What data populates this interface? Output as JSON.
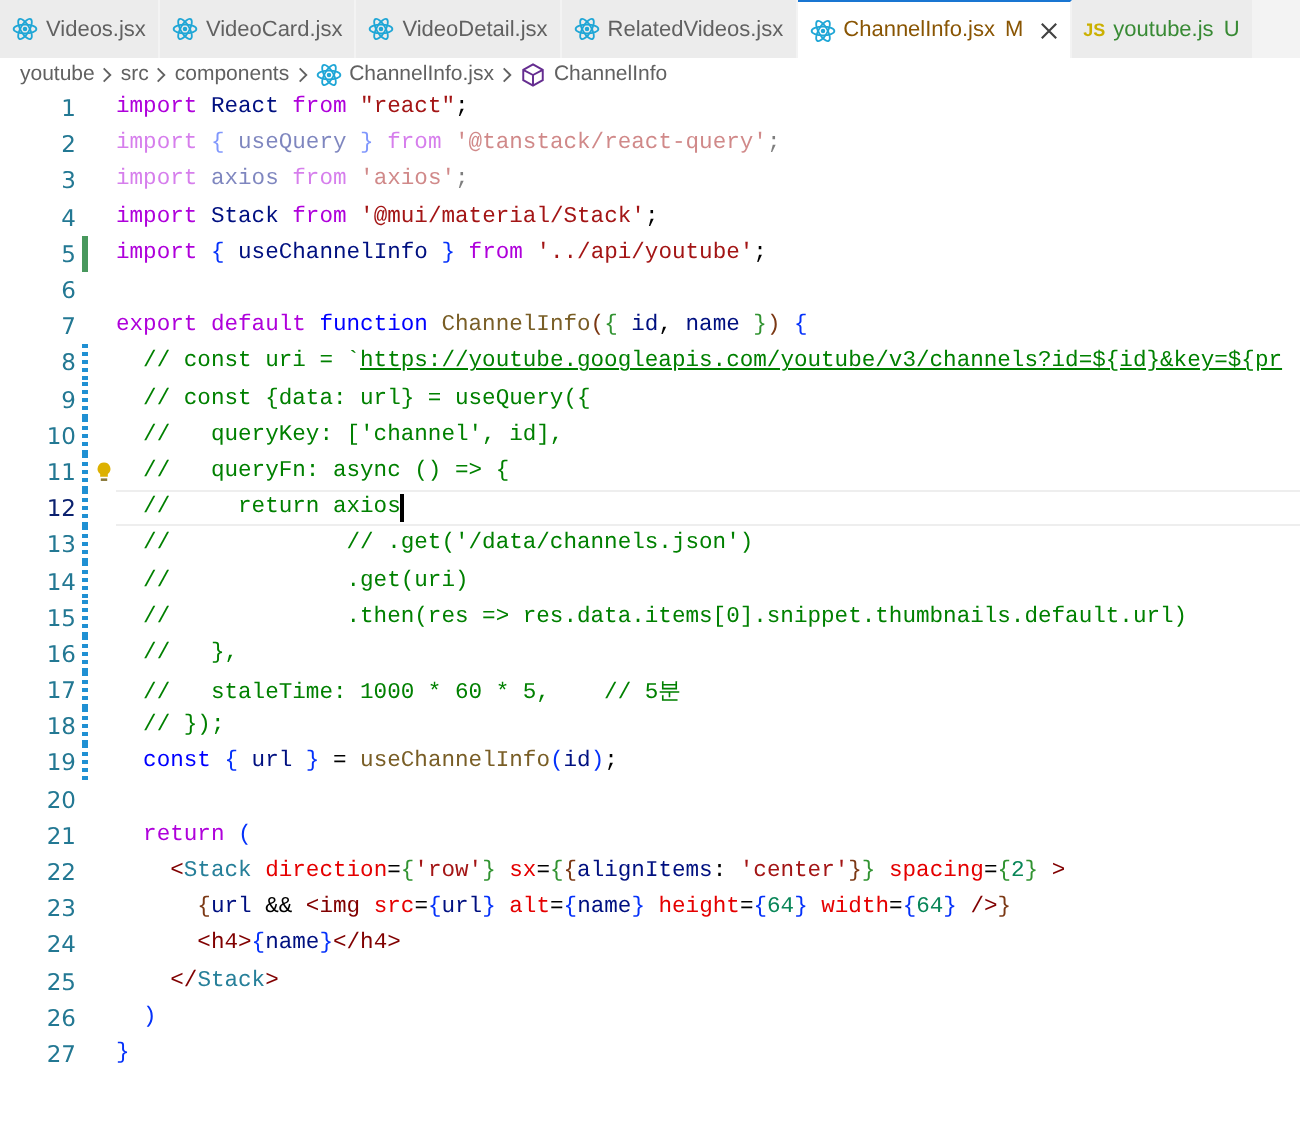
{
  "tabs": [
    {
      "label": "Videos.jsx",
      "kind": "react",
      "selected": false
    },
    {
      "label": "VideoCard.jsx",
      "kind": "react",
      "selected": false
    },
    {
      "label": "VideoDetail.jsx",
      "kind": "react",
      "selected": false
    },
    {
      "label": "RelatedVideos.jsx",
      "kind": "react",
      "selected": false
    },
    {
      "label": "ChannelInfo.jsx",
      "kind": "react",
      "selected": true,
      "status": {
        "letter": "M",
        "kind": "modified"
      }
    },
    {
      "label": "youtube.js",
      "kind": "js",
      "icon_label": "JS",
      "selected": false,
      "status": {
        "letter": "U",
        "kind": "untracked"
      }
    }
  ],
  "breadcrumb": [
    {
      "label": "youtube",
      "kind": "folder"
    },
    {
      "label": "src",
      "kind": "folder"
    },
    {
      "label": "components",
      "kind": "folder"
    },
    {
      "label": "ChannelInfo.jsx",
      "kind": "react"
    },
    {
      "label": "ChannelInfo",
      "kind": "symbol"
    }
  ],
  "lines": [
    {
      "number": "1",
      "current": false,
      "tokens": [
        {
          "t": "import",
          "kind": "kw"
        },
        {
          "t": " React",
          "kind": "var"
        },
        {
          "t": " from",
          "kind": "kw"
        },
        {
          "t": " \"react\"",
          "kind": "str"
        },
        {
          "t": ";",
          "kind": "p"
        }
      ]
    },
    {
      "number": "2",
      "current": false,
      "faded": true,
      "tokens": [
        {
          "t": "import",
          "kind": "kw"
        },
        {
          "t": " {",
          "kind": "b1"
        },
        {
          "t": " useQuery",
          "kind": "var"
        },
        {
          "t": " }",
          "kind": "b1"
        },
        {
          "t": " from",
          "kind": "kw"
        },
        {
          "t": " '@tanstack/react-query'",
          "kind": "str"
        },
        {
          "t": ";",
          "kind": "p"
        }
      ]
    },
    {
      "number": "3",
      "current": false,
      "faded": true,
      "tokens": [
        {
          "t": "import",
          "kind": "kw"
        },
        {
          "t": " axios",
          "kind": "var"
        },
        {
          "t": " from",
          "kind": "kw"
        },
        {
          "t": " 'axios'",
          "kind": "str"
        },
        {
          "t": ";",
          "kind": "p"
        }
      ]
    },
    {
      "number": "4",
      "current": false,
      "tokens": [
        {
          "t": "import",
          "kind": "kw"
        },
        {
          "t": " Stack",
          "kind": "var"
        },
        {
          "t": " from",
          "kind": "kw"
        },
        {
          "t": " '@mui/material/Stack'",
          "kind": "str"
        },
        {
          "t": ";",
          "kind": "p"
        }
      ]
    },
    {
      "number": "5",
      "kind": "added",
      "current": false,
      "tokens": [
        {
          "t": "import",
          "kind": "kw"
        },
        {
          "t": " {",
          "kind": "b1"
        },
        {
          "t": " useChannelInfo",
          "kind": "var"
        },
        {
          "t": " }",
          "kind": "b1"
        },
        {
          "t": " from",
          "kind": "kw"
        },
        {
          "t": " '../api/youtube'",
          "kind": "str"
        },
        {
          "t": ";",
          "kind": "p"
        }
      ]
    },
    {
      "number": "6",
      "current": false
    },
    {
      "number": "7",
      "current": false,
      "tokens": [
        {
          "t": "export",
          "kind": "kw"
        },
        {
          "t": " default",
          "kind": "kw"
        },
        {
          "t": " function",
          "kind": "kw2"
        },
        {
          "t": " ChannelInfo",
          "kind": "fn"
        },
        {
          "t": "(",
          "kind": "b3"
        },
        {
          "t": "{",
          "kind": "b2"
        },
        {
          "t": " id",
          "kind": "var"
        },
        {
          "t": ",",
          "kind": "p"
        },
        {
          "t": " name",
          "kind": "var"
        },
        {
          "t": " }",
          "kind": "b2"
        },
        {
          "t": ")",
          "kind": "b3"
        },
        {
          "t": " {",
          "kind": "b1"
        }
      ]
    },
    {
      "number": "8",
      "kind": "modified",
      "current": false,
      "tokens": [
        {
          "t": "  // const uri = `",
          "kind": "com"
        },
        {
          "t": "https://youtube.googleapis.com/youtube/v3/channels?id=${id}&key=${pr",
          "kind": "link"
        }
      ]
    },
    {
      "number": "9",
      "kind": "modified",
      "current": false,
      "tokens": [
        {
          "t": "  // const {data: url} = useQuery({",
          "kind": "com"
        }
      ]
    },
    {
      "number": "10",
      "kind": "modified",
      "current": false,
      "tokens": [
        {
          "t": "  //   queryKey: ['channel', id],",
          "kind": "com"
        }
      ]
    },
    {
      "number": "11",
      "kind": "modified",
      "current": false,
      "lightbulb": true,
      "tokens": [
        {
          "t": "  //   queryFn: async () => {",
          "kind": "com"
        }
      ]
    },
    {
      "number": "12",
      "kind": "modified",
      "current": true,
      "cursor": true,
      "tokens": [
        {
          "t": "  //     return axios",
          "kind": "com"
        }
      ]
    },
    {
      "number": "13",
      "kind": "modified",
      "current": false,
      "tokens": [
        {
          "t": "  //             // .get('/data/channels.json')",
          "kind": "com"
        }
      ]
    },
    {
      "number": "14",
      "kind": "modified",
      "current": false,
      "tokens": [
        {
          "t": "  //             .get(uri)",
          "kind": "com"
        }
      ]
    },
    {
      "number": "15",
      "kind": "modified",
      "current": false,
      "tokens": [
        {
          "t": "  //             .then(res => res.data.items[0].snippet.thumbnails.default.url)",
          "kind": "com"
        }
      ]
    },
    {
      "number": "16",
      "kind": "modified",
      "current": false,
      "tokens": [
        {
          "t": "  //   },",
          "kind": "com"
        }
      ]
    },
    {
      "number": "17",
      "kind": "modified",
      "current": false,
      "tokens": [
        {
          "t": "  //   staleTime: 1000 * 60 * 5,    // 5분",
          "kind": "com"
        }
      ]
    },
    {
      "number": "18",
      "kind": "modified",
      "current": false,
      "tokens": [
        {
          "t": "  // });",
          "kind": "com"
        }
      ]
    },
    {
      "number": "19",
      "kind": "modified",
      "current": false,
      "tokens": [
        {
          "t": "  const",
          "kind": "kw2"
        },
        {
          "t": " {",
          "kind": "b1"
        },
        {
          "t": " url",
          "kind": "var"
        },
        {
          "t": " }",
          "kind": "b1"
        },
        {
          "t": " =",
          "kind": "p"
        },
        {
          "t": " useChannelInfo",
          "kind": "fn"
        },
        {
          "t": "(",
          "kind": "b1"
        },
        {
          "t": "id",
          "kind": "var"
        },
        {
          "t": ")",
          "kind": "b1"
        },
        {
          "t": ";",
          "kind": "p"
        }
      ]
    },
    {
      "number": "20",
      "current": false
    },
    {
      "number": "21",
      "current": false,
      "tokens": [
        {
          "t": "  return",
          "kind": "kw"
        },
        {
          "t": " (",
          "kind": "b1"
        }
      ]
    },
    {
      "number": "22",
      "current": false,
      "tokens": [
        {
          "t": "    <",
          "kind": "tag"
        },
        {
          "t": "Stack",
          "kind": "comp"
        },
        {
          "t": " direction",
          "kind": "attr"
        },
        {
          "t": "=",
          "kind": "p"
        },
        {
          "t": "{",
          "kind": "b2"
        },
        {
          "t": "'row'",
          "kind": "str"
        },
        {
          "t": "}",
          "kind": "b2"
        },
        {
          "t": " sx",
          "kind": "attr"
        },
        {
          "t": "=",
          "kind": "p"
        },
        {
          "t": "{",
          "kind": "b2"
        },
        {
          "t": "{",
          "kind": "b3"
        },
        {
          "t": "alignItems",
          "kind": "var"
        },
        {
          "t": ":",
          "kind": "p"
        },
        {
          "t": " 'center'",
          "kind": "str"
        },
        {
          "t": "}",
          "kind": "b3"
        },
        {
          "t": "}",
          "kind": "b2"
        },
        {
          "t": " spacing",
          "kind": "attr"
        },
        {
          "t": "=",
          "kind": "p"
        },
        {
          "t": "{",
          "kind": "b2"
        },
        {
          "t": "2",
          "kind": "num"
        },
        {
          "t": "}",
          "kind": "b2"
        },
        {
          "t": " >",
          "kind": "tag"
        }
      ]
    },
    {
      "number": "23",
      "current": false,
      "tokens": [
        {
          "t": "      {",
          "kind": "b3"
        },
        {
          "t": "url",
          "kind": "var"
        },
        {
          "t": " &&",
          "kind": "p"
        },
        {
          "t": " <",
          "kind": "tag"
        },
        {
          "t": "img",
          "kind": "tag"
        },
        {
          "t": " src",
          "kind": "attr"
        },
        {
          "t": "=",
          "kind": "p"
        },
        {
          "t": "{",
          "kind": "b1"
        },
        {
          "t": "url",
          "kind": "var"
        },
        {
          "t": "}",
          "kind": "b1"
        },
        {
          "t": " alt",
          "kind": "attr"
        },
        {
          "t": "=",
          "kind": "p"
        },
        {
          "t": "{",
          "kind": "b1"
        },
        {
          "t": "name",
          "kind": "var"
        },
        {
          "t": "}",
          "kind": "b1"
        },
        {
          "t": " height",
          "kind": "attr"
        },
        {
          "t": "=",
          "kind": "p"
        },
        {
          "t": "{",
          "kind": "b1"
        },
        {
          "t": "64",
          "kind": "num"
        },
        {
          "t": "}",
          "kind": "b1"
        },
        {
          "t": " width",
          "kind": "attr"
        },
        {
          "t": "=",
          "kind": "p"
        },
        {
          "t": "{",
          "kind": "b1"
        },
        {
          "t": "64",
          "kind": "num"
        },
        {
          "t": "}",
          "kind": "b1"
        },
        {
          "t": " />",
          "kind": "tag"
        },
        {
          "t": "}",
          "kind": "b3"
        }
      ]
    },
    {
      "number": "24",
      "current": false,
      "tokens": [
        {
          "t": "      <h4>",
          "kind": "tag"
        },
        {
          "t": "{",
          "kind": "b1"
        },
        {
          "t": "name",
          "kind": "var"
        },
        {
          "t": "}",
          "kind": "b1"
        },
        {
          "t": "</h4>",
          "kind": "tag"
        }
      ]
    },
    {
      "number": "25",
      "current": false,
      "tokens": [
        {
          "t": "    </",
          "kind": "tag"
        },
        {
          "t": "Stack",
          "kind": "comp"
        },
        {
          "t": ">",
          "kind": "tag"
        }
      ]
    },
    {
      "number": "26",
      "current": false,
      "tokens": [
        {
          "t": "  )",
          "kind": "b1"
        }
      ]
    },
    {
      "number": "27",
      "current": false,
      "tokens": [
        {
          "t": "}",
          "kind": "b1"
        }
      ]
    }
  ]
}
